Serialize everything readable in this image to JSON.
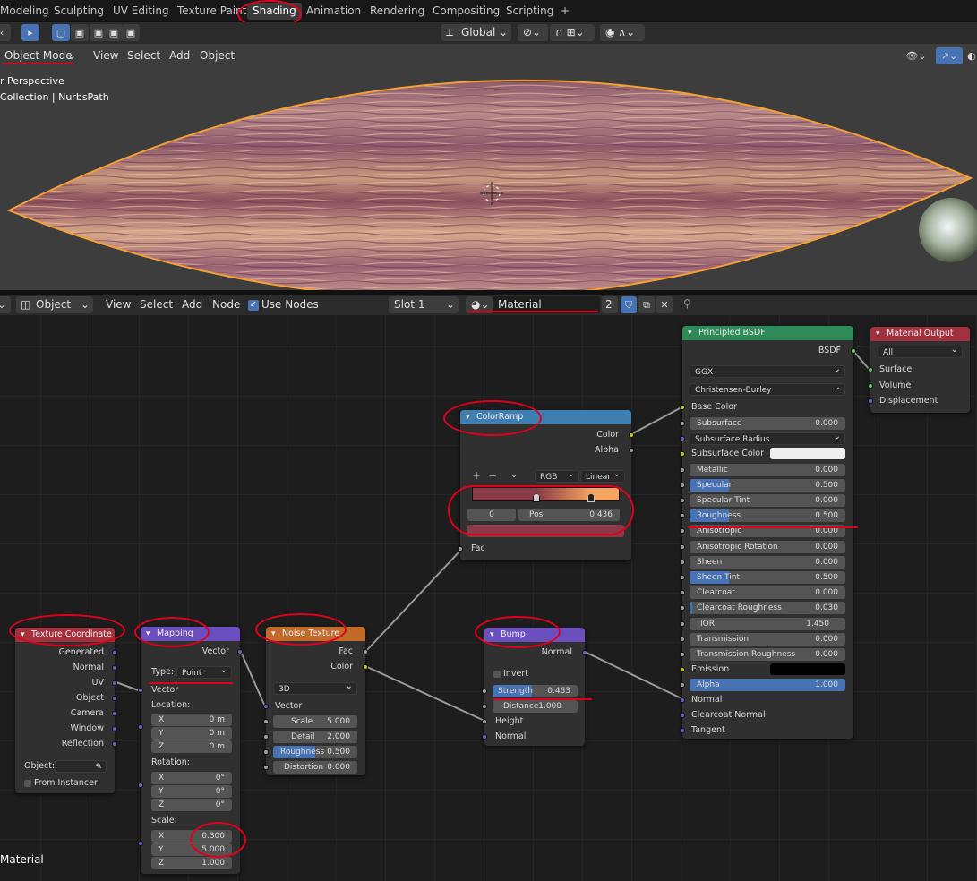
{
  "tabs": [
    "Modeling",
    "Sculpting",
    "UV Editing",
    "Texture Paint",
    "Shading",
    "Animation",
    "Rendering",
    "Compositing",
    "Scripting",
    "+"
  ],
  "viewport": {
    "mode": "Object Mode",
    "menus": [
      "View",
      "Select",
      "Add",
      "Object"
    ],
    "transform": "Global",
    "info_line1": "r Perspective",
    "info_line2": "Collection | NurbsPath"
  },
  "node_header": {
    "type": "Object",
    "menus": [
      "View",
      "Select",
      "Add",
      "Node"
    ],
    "use_nodes": "Use Nodes",
    "slot": "Slot 1",
    "material": "Material",
    "users": "2",
    "footer": "Material"
  },
  "texcoord": {
    "title": "Texture Coordinate",
    "outputs": [
      "Generated",
      "Normal",
      "UV",
      "Object",
      "Camera",
      "Window",
      "Reflection"
    ],
    "object_label": "Object:",
    "from_instancer": "From Instancer"
  },
  "mapping": {
    "title": "Mapping",
    "out": "Vector",
    "type_label": "Type:",
    "type_value": "Point",
    "in": "Vector",
    "location_label": "Location:",
    "loc": [
      [
        "X",
        "0 m"
      ],
      [
        "Y",
        "0 m"
      ],
      [
        "Z",
        "0 m"
      ]
    ],
    "rotation_label": "Rotation:",
    "rot": [
      [
        "X",
        "0°"
      ],
      [
        "Y",
        "0°"
      ],
      [
        "Z",
        "0°"
      ]
    ],
    "scale_label": "Scale:",
    "scale": [
      [
        "X",
        "0.300"
      ],
      [
        "Y",
        "5.000"
      ],
      [
        "Z",
        "1.000"
      ]
    ]
  },
  "noise": {
    "title": "Noise Texture",
    "fac": "Fac",
    "color": "Color",
    "dim": "3D",
    "vector": "Vector",
    "fields": [
      [
        "Scale",
        "5.000"
      ],
      [
        "Detail",
        "2.000"
      ],
      [
        "Roughness",
        "0.500"
      ],
      [
        "Distortion",
        "0.000"
      ]
    ]
  },
  "ramp": {
    "title": "ColorRamp",
    "color": "Color",
    "alpha": "Alpha",
    "plus": "+",
    "minus": "−",
    "mode": "RGB",
    "interp": "Linear",
    "index": "0",
    "pos_label": "Pos",
    "pos_value": "0.436",
    "fac": "Fac",
    "color_left": "#8b3a48",
    "color_right": "#f5a55f",
    "stop_color": "#8b3a48"
  },
  "bump": {
    "title": "Bump",
    "normal_out": "Normal",
    "invert": "Invert",
    "strength_label": "Strength",
    "strength": "0.463",
    "distance_label": "Distance",
    "distance": "1.000",
    "height": "Height",
    "normal_in": "Normal"
  },
  "bsdf": {
    "title": "Principled BSDF",
    "out": "BSDF",
    "dist": "GGX",
    "sss": "Christensen-Burley",
    "base_color": "Base Color",
    "rows": [
      [
        "Subsurface",
        "0.000"
      ],
      [
        "Subsurface Radius",
        ""
      ],
      [
        "Subsurface Color",
        ""
      ],
      [
        "Metallic",
        "0.000"
      ],
      [
        "Specular",
        "0.500"
      ],
      [
        "Specular Tint",
        "0.000"
      ],
      [
        "Roughness",
        "0.500"
      ],
      [
        "Anisotropic",
        "0.000"
      ],
      [
        "Anisotropic Rotation",
        "0.000"
      ],
      [
        "Sheen",
        "0.000"
      ],
      [
        "Sheen Tint",
        "0.500"
      ],
      [
        "Clearcoat",
        "0.000"
      ],
      [
        "Clearcoat Roughness",
        "0.030"
      ],
      [
        "IOR",
        "1.450"
      ],
      [
        "Transmission",
        "0.000"
      ],
      [
        "Transmission Roughness",
        "0.000"
      ],
      [
        "Emission",
        ""
      ],
      [
        "Alpha",
        "1.000"
      ]
    ],
    "normal": "Normal",
    "cc_normal": "Clearcoat Normal",
    "tangent": "Tangent"
  },
  "output": {
    "title": "Material Output",
    "target": "All",
    "inputs": [
      "Surface",
      "Volume",
      "Displacement"
    ]
  },
  "colors": {
    "accent": "#4772b3",
    "annot": "#e0001c",
    "texcoord_head": "#a2303d",
    "mapping_head": "#6b4fbf",
    "noise_head": "#c26a2a",
    "ramp_head": "#3f7fb0",
    "bump_head": "#6b4fbf",
    "bsdf_head": "#2e8b57",
    "output_head": "#a2303d"
  }
}
